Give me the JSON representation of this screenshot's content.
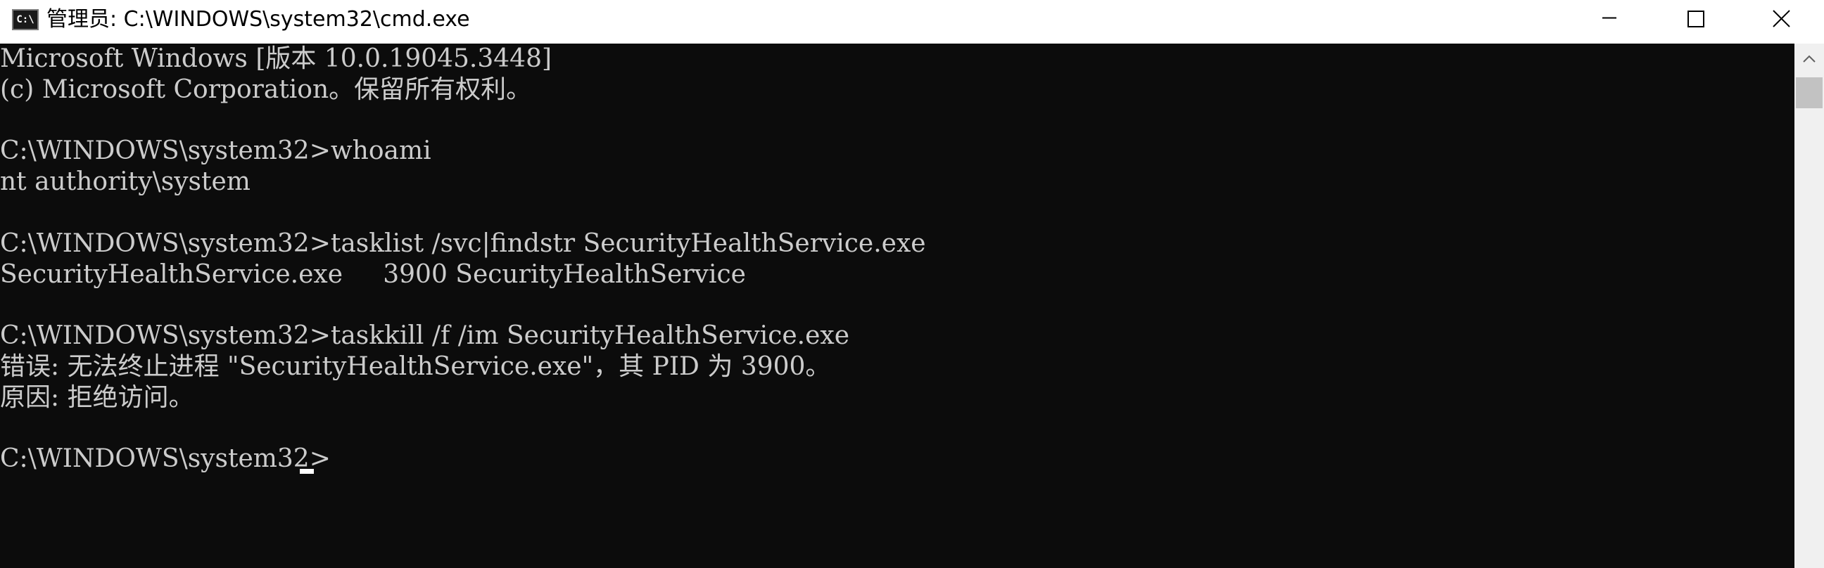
{
  "window": {
    "icon_text": "C:\\",
    "title": "管理员: C:\\WINDOWS\\system32\\cmd.exe"
  },
  "controls": {
    "minimize": "minimize",
    "maximize": "maximize",
    "close": "close"
  },
  "console": {
    "lines": [
      "Microsoft Windows [版本 10.0.19045.3448]",
      "(c) Microsoft Corporation。保留所有权利。",
      "",
      "C:\\WINDOWS\\system32>whoami",
      "nt authority\\system",
      "",
      "C:\\WINDOWS\\system32>tasklist /svc|findstr SecurityHealthService.exe",
      "SecurityHealthService.exe     3900 SecurityHealthService",
      "",
      "C:\\WINDOWS\\system32>taskkill /f /im SecurityHealthService.exe",
      "错误: 无法终止进程 \"SecurityHealthService.exe\"，其 PID 为 3900。",
      "原因: 拒绝访问。",
      "",
      "C:\\WINDOWS\\system32>"
    ]
  },
  "icons": {
    "app": "console-icon",
    "minimize": "minimize-icon",
    "maximize": "maximize-icon",
    "close": "close-icon",
    "scroll_up": "scroll-up-arrow-icon"
  },
  "colors": {
    "console_background": "#0c0c0c",
    "console_text": "#cccccc",
    "titlebar": "#ffffff",
    "scrollbar_track": "#f0f0f0",
    "scrollbar_thumb": "#c2c2c2"
  }
}
